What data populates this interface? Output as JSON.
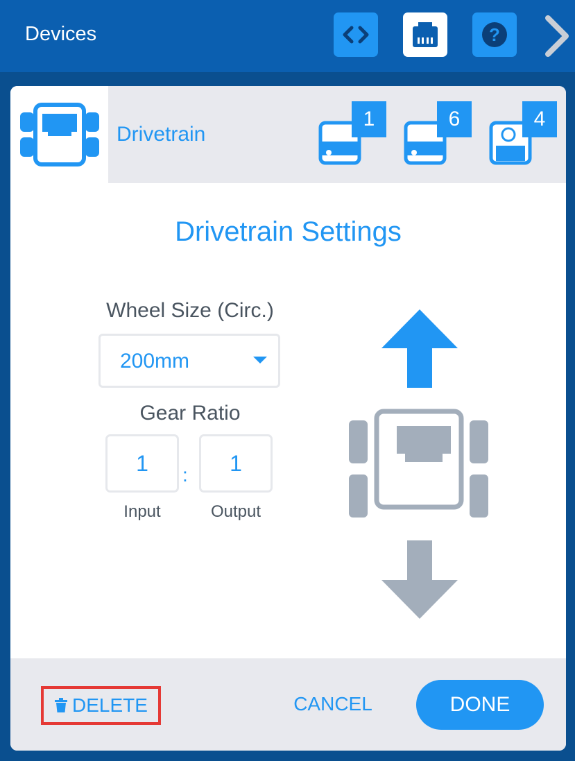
{
  "header": {
    "title": "Devices",
    "buttons": [
      {
        "icon": "code-icon"
      },
      {
        "icon": "devices-port-icon"
      },
      {
        "icon": "help-icon"
      }
    ],
    "next_icon": "chevron-right-icon"
  },
  "device_strip": {
    "selected_device_label": "Drivetrain",
    "ports": [
      {
        "badge": "1",
        "icon": "motor-icon"
      },
      {
        "badge": "6",
        "icon": "motor-icon"
      },
      {
        "badge": "4",
        "icon": "gyro-sensor-icon"
      }
    ]
  },
  "settings": {
    "title": "Drivetrain Settings",
    "wheel_size": {
      "label": "Wheel Size (Circ.)",
      "selected": "200mm"
    },
    "gear_ratio": {
      "label": "Gear Ratio",
      "input_value": "1",
      "output_value": "1",
      "separator": ":",
      "input_caption": "Input",
      "output_caption": "Output"
    }
  },
  "footer": {
    "delete_label": "DELETE",
    "cancel_label": "CANCEL",
    "done_label": "DONE"
  },
  "colors": {
    "accent": "#2196f3",
    "header_bg": "#0b5fb0",
    "page_bg": "#0a4f8f",
    "strip_bg": "#e8e9ee",
    "graphic_gray": "#a3aebb",
    "highlight": "#e53935"
  }
}
